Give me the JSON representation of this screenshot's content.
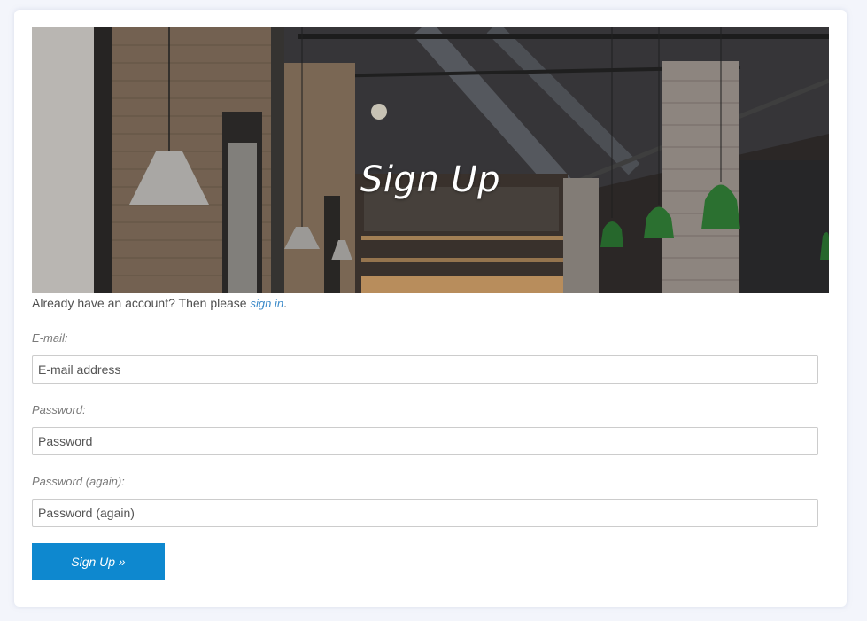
{
  "hero": {
    "title": "Sign Up"
  },
  "signin_prompt": {
    "text": "Already have an account? Then please ",
    "link": "sign in",
    "suffix": "."
  },
  "form": {
    "email_label": "E-mail:",
    "email_placeholder": "E-mail address",
    "email_value": "",
    "password_label": "Password:",
    "password_placeholder": "Password",
    "password_value": "",
    "password2_label": "Password (again):",
    "password2_placeholder": "Password (again)",
    "password2_value": "",
    "submit_label": "Sign Up »"
  },
  "colors": {
    "accent": "#0e88cf",
    "link": "#3b8ac9",
    "background": "#f3f5fb"
  }
}
